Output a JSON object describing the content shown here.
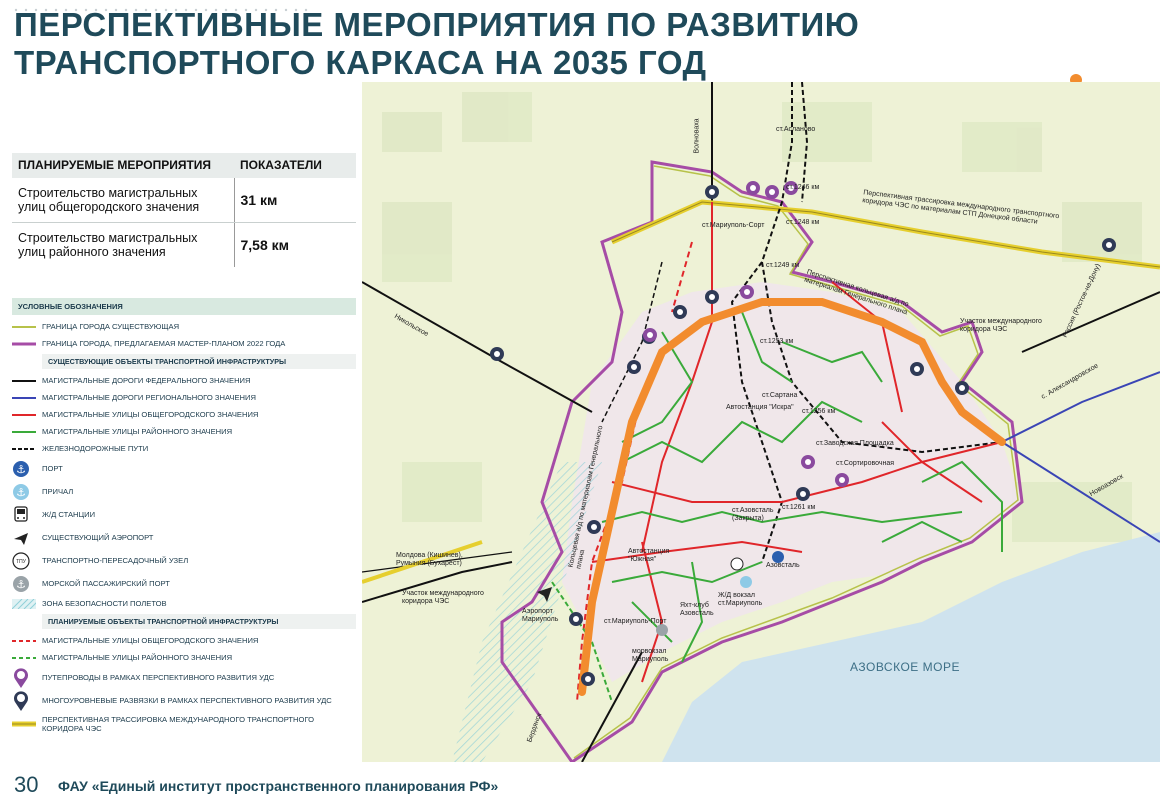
{
  "title": "ПЕРСПЕКТИВНЫЕ МЕРОПРИЯТИЯ ПО РАЗВИТИЮ ТРАНСПОРТНОГО КАРКАСА НА 2035 ГОД",
  "metrics": {
    "col_activity": "ПЛАНИРУЕМЫЕ МЕРОПРИЯТИЯ",
    "col_value": "ПОКАЗАТЕЛИ",
    "rows": [
      {
        "label": "Строительство магистральных улиц общегородского значения",
        "value": "31 км"
      },
      {
        "label": "Строительство магистральных улиц районного значения",
        "value": "7,58 км"
      }
    ]
  },
  "legend": {
    "heading": "УСЛОВНЫЕ ОБОЗНАЧЕНИЯ",
    "boundary_existing": "ГРАНИЦА ГОРОДА СУЩЕСТВУЮЩАЯ",
    "boundary_planned": "ГРАНИЦА ГОРОДА, ПРЕДЛАГАЕМАЯ МАСТЕР-ПЛАНОМ 2022 ГОДА",
    "existing_heading": "СУЩЕСТВУЮЩИЕ ОБЪЕКТЫ ТРАНСПОРТНОЙ ИНФРАСТРУКТУРЫ",
    "federal_roads": "МАГИСТРАЛЬНЫЕ ДОРОГИ ФЕДЕРАЛЬНОГО ЗНАЧЕНИЯ",
    "regional_roads": "МАГИСТРАЛЬНЫЕ ДОРОГИ РЕГИОНАЛЬНОГО ЗНАЧЕНИЯ",
    "city_streets": "МАГИСТРАЛЬНЫЕ УЛИЦЫ ОБЩЕГОРОДСКОГО ЗНАЧЕНИЯ",
    "district_streets": "МАГИСТРАЛЬНЫЕ УЛИЦЫ РАЙОННОГО ЗНАЧЕНИЯ",
    "railways": "ЖЕЛЕЗНОДОРОЖНЫЕ ПУТИ",
    "port": "ПОРТ",
    "pier": "ПРИЧАЛ",
    "rail_stations": "Ж/Д СТАНЦИИ",
    "airport": "СУЩЕСТВУЮЩИЙ АЭРОПОРТ",
    "tpu": "ТРАНСПОРТНО-ПЕРЕСАДОЧНЫЙ УЗЕЛ",
    "sea_port": "МОРСКОЙ ПАССАЖИРСКИЙ ПОРТ",
    "safety_zone": "ЗОНА БЕЗОПАСНОСТИ ПОЛЕТОВ",
    "planned_heading": "ПЛАНИРУЕМЫЕ ОБЪЕКТЫ ТРАНСПОРТНОЙ ИНФРАСТРУКТУРЫ",
    "planned_city": "МАГИСТРАЛЬНЫЕ УЛИЦЫ ОБЩЕГОРОДСКОГО ЗНАЧЕНИЯ",
    "planned_district": "МАГИСТРАЛЬНЫЕ УЛИЦЫ РАЙОННОГО ЗНАЧЕНИЯ",
    "overpasses": "ПУТЕПРОВОДЫ В РАМКАХ ПЕРСПЕКТИВНОГО РАЗВИТИЯ УДС",
    "interchanges": "МНОГОУРОВНЕВЫЕ РАЗВЯЗКИ В РАМКАХ ПЕРСПЕКТИВНОГО РАЗВИТИЯ УДС",
    "corridor": "ПЕРСПЕКТИВНАЯ ТРАССИРОВКА МЕЖДУНАРОДНОГО ТРАНСПОРТНОГО КОРИДОРА ЧЭС",
    "tpu_glyph": "ТПУ"
  },
  "map_labels": {
    "aslanovo": "ст.Асланово",
    "km1246": "ст.1246 км",
    "km1248": "ст.1248 км",
    "mariupol_sort": "ст.Мариуполь-Сорт",
    "km1249": "ст.1249 км",
    "volnovakha": "Волноваха",
    "corridor_note": "Перспективная трассировка международного транспортного коридора ЧЭС по материалам СТП Донецкой области",
    "ring_note": "Перспективная кольцевая а/д по материалам Генерального плана",
    "km1253": "ст.1253 км",
    "nikolskoe": "Никольское",
    "sartana": "ст.Сартана",
    "iskra": "Автостанция \"Искра\"",
    "km1256": "ст.1256 км",
    "zavodskaya": "ст.Заводская Площадка",
    "sortirovochnaya": "ст.Сортировочная",
    "chs_section_right": "Участок международного коридора ЧЭС",
    "rossiya": "Россия (Ростов-на-Дону)",
    "aleksandrovskoe": "с. Александровское",
    "novoazovsk": "Новоазовск",
    "azovstal_st": "ст.Азовсталь (Закрыта)",
    "km1261": "ст.1261 км",
    "southern_bus": "Автостанция \"Южная\"",
    "azovstal": "Азовсталь",
    "rail_station": "Ж/Д вокзал ст.Мариуполь",
    "yacht_club": "Яхт-клуб Азовсталь",
    "mariupol_port_st": "ст.Мариуполь-Порт",
    "seaport": "морвокзал Мариуполь",
    "airport": "Аэропорт Мариуполь",
    "moldova": "Молдова (Кишинев), Румыния (Бухарест)",
    "chs_section_left": "Участок международного коридора ЧЭС",
    "ring_vertical": "Кольцевая а/д по материалам Генерального плана",
    "berdyansk": "Бердянск",
    "sea": "АЗОВСКОЕ МОРЕ",
    "tpu_glyph": "ТПУ"
  },
  "colors": {
    "title": "#1f4a5a",
    "boundary_existing": "#b7c24a",
    "boundary_planned": "#a64ca6",
    "federal": "#111111",
    "regional": "#3a45b5",
    "city": "#e0262a",
    "district": "#3aaa3a",
    "ring": "#f28c2e",
    "corridor": "#e6cf2e",
    "sea": "#cfe3ee",
    "land": "#eef2d6"
  },
  "footer": {
    "page": "30",
    "org": "ФАУ «Единый институт пространственного планирования РФ»"
  }
}
